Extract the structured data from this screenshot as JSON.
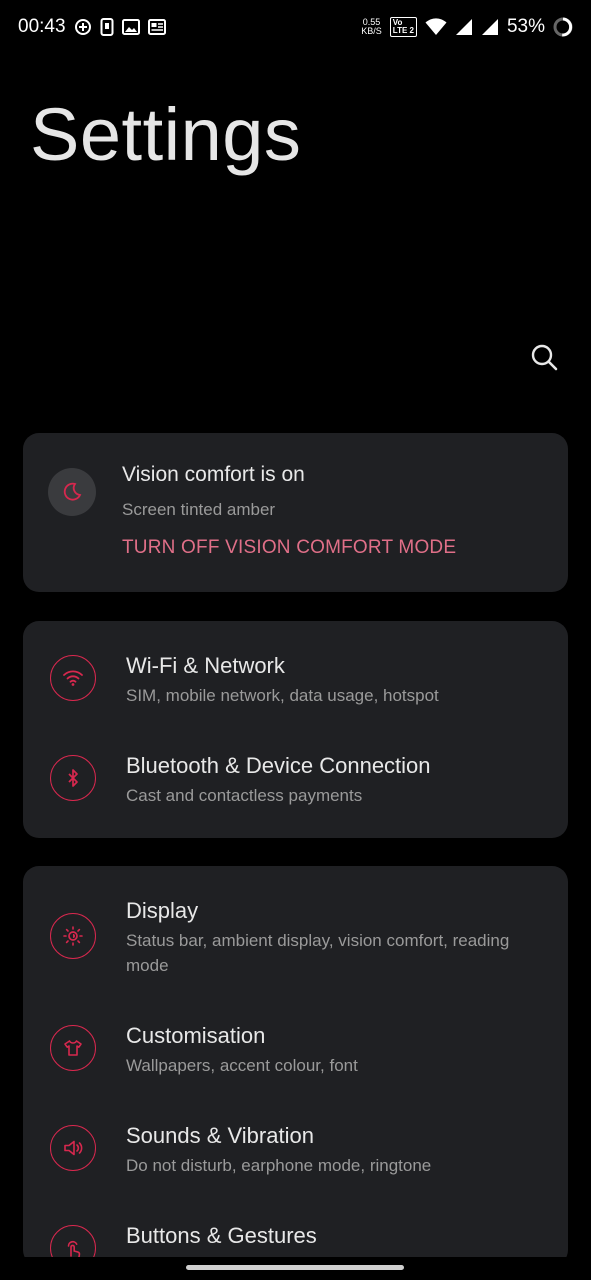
{
  "status_bar": {
    "time": "00:43",
    "net_speed_value": "0.55",
    "net_speed_unit": "KB/S",
    "volte_top": "Vo",
    "volte_bottom": "LTE 2",
    "battery_percent": "53%"
  },
  "header": {
    "title": "Settings"
  },
  "vision_card": {
    "title": "Vision comfort is on",
    "subtitle": "Screen tinted amber",
    "action": "TURN OFF VISION COMFORT MODE"
  },
  "network_card": {
    "items": [
      {
        "title": "Wi-Fi & Network",
        "subtitle": "SIM, mobile network, data usage, hotspot",
        "icon": "wifi-icon"
      },
      {
        "title": "Bluetooth & Device Connection",
        "subtitle": "Cast and contactless payments",
        "icon": "bluetooth-icon"
      }
    ]
  },
  "display_card": {
    "items": [
      {
        "title": "Display",
        "subtitle": "Status bar, ambient display, vision comfort, reading mode",
        "icon": "brightness-icon"
      },
      {
        "title": "Customisation",
        "subtitle": "Wallpapers, accent colour, font",
        "icon": "tshirt-icon"
      },
      {
        "title": "Sounds & Vibration",
        "subtitle": "Do not disturb, earphone mode, ringtone",
        "icon": "speaker-icon"
      },
      {
        "title": "Buttons & Gestures",
        "subtitle": "",
        "icon": "touch-icon"
      }
    ]
  },
  "colors": {
    "accent": "#d7284e",
    "action_text": "#e06f88",
    "card_bg": "#1f2023",
    "background": "#000000"
  }
}
